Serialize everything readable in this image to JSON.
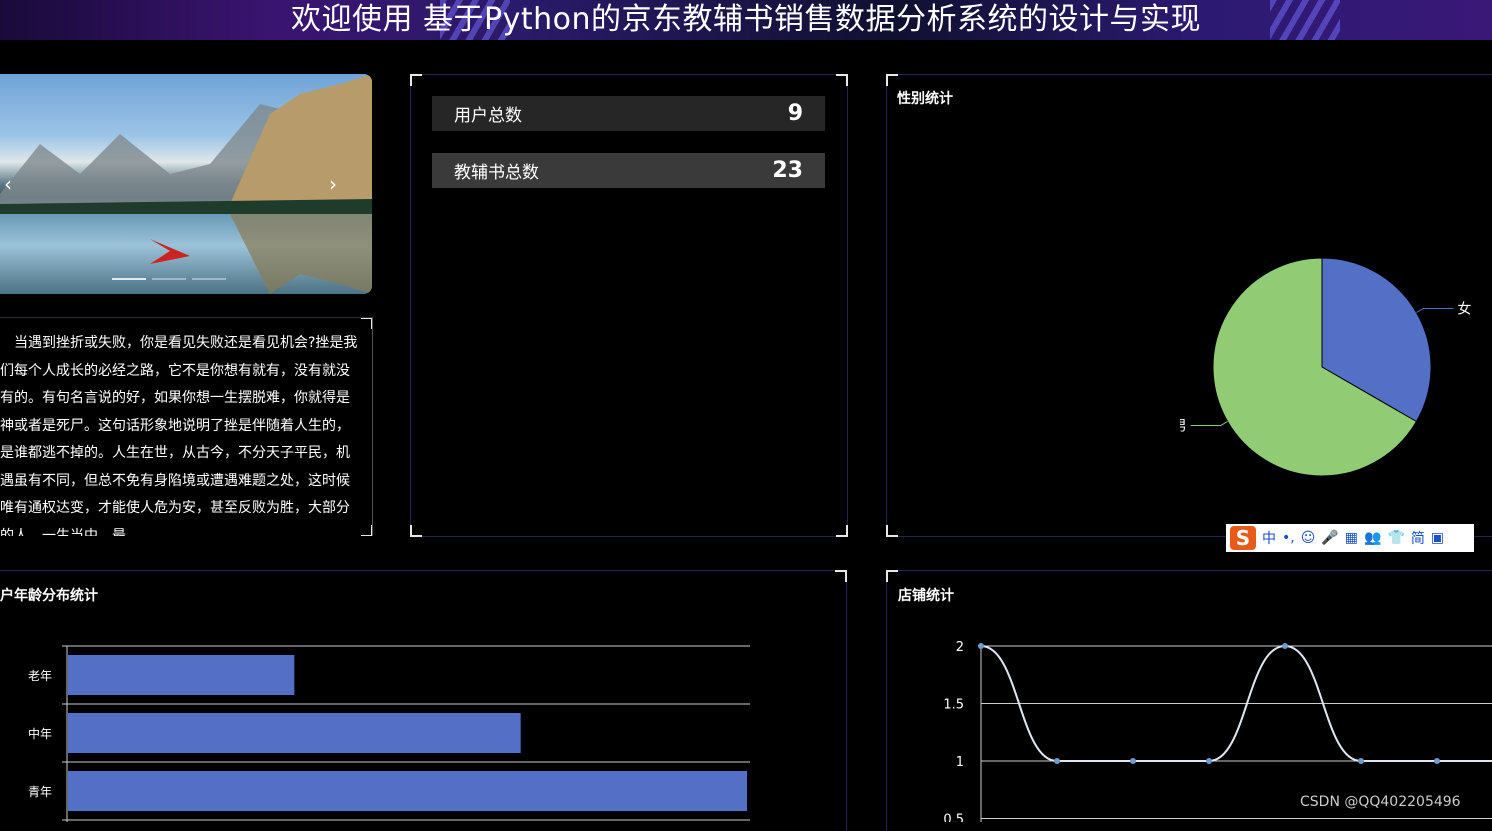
{
  "header": {
    "title": "欢迎使用 基于Python的京东教辅书销售数据分析系统的设计与实现"
  },
  "carousel": {
    "prev_icon": "‹",
    "next_icon": "›"
  },
  "article": {
    "text": "当遇到挫折或失败，你是看见失败还是看见机会?挫是我们每个人成长的必经之路，它不是你想有就有，没有就没有的。有句名言说的好，如果你想一生摆脱难，你就得是神或者是死尸。这句话形象地说明了挫是伴随着人生的，是谁都逃不掉的。人生在世，从古今，不分天子平民，机遇虽有不同，但总不免有身陷境或遭遇难题之处，这时候唯有通权达变，才能使人危为安，甚至反败为胜，大部分的人，一生当中，最"
  },
  "stats": [
    {
      "label": "用户总数",
      "value": "9"
    },
    {
      "label": "教辅书总数",
      "value": "23"
    }
  ],
  "gender_panel": {
    "title": "性别统计"
  },
  "age_panel": {
    "title": "户年龄分布统计"
  },
  "shop_panel": {
    "title": "店铺统计"
  },
  "ime_bar": {
    "chars": [
      "中",
      "•,",
      "☺",
      "🎤",
      "▦",
      "👥",
      "👕",
      "简",
      "▣"
    ]
  },
  "watermark": "CSDN @QQ402205496",
  "colors": {
    "accent_blue": "#5470c6",
    "accent_green": "#91cc75",
    "line": "#e0e6f1"
  },
  "chart_data": [
    {
      "type": "pie",
      "labels": [
        "女",
        "男"
      ],
      "values": [
        3,
        6
      ]
    },
    {
      "type": "bar",
      "orientation": "horizontal",
      "categories": [
        "老年",
        "中年",
        "青年"
      ],
      "values": [
        1,
        2,
        3
      ]
    },
    {
      "type": "line",
      "smooth": true,
      "values": [
        2,
        1,
        1,
        1,
        2,
        1,
        1,
        1
      ],
      "ytick_labels": [
        "2",
        "1.5",
        "1",
        "0.5"
      ],
      "ylim": [
        0.5,
        2
      ]
    }
  ]
}
